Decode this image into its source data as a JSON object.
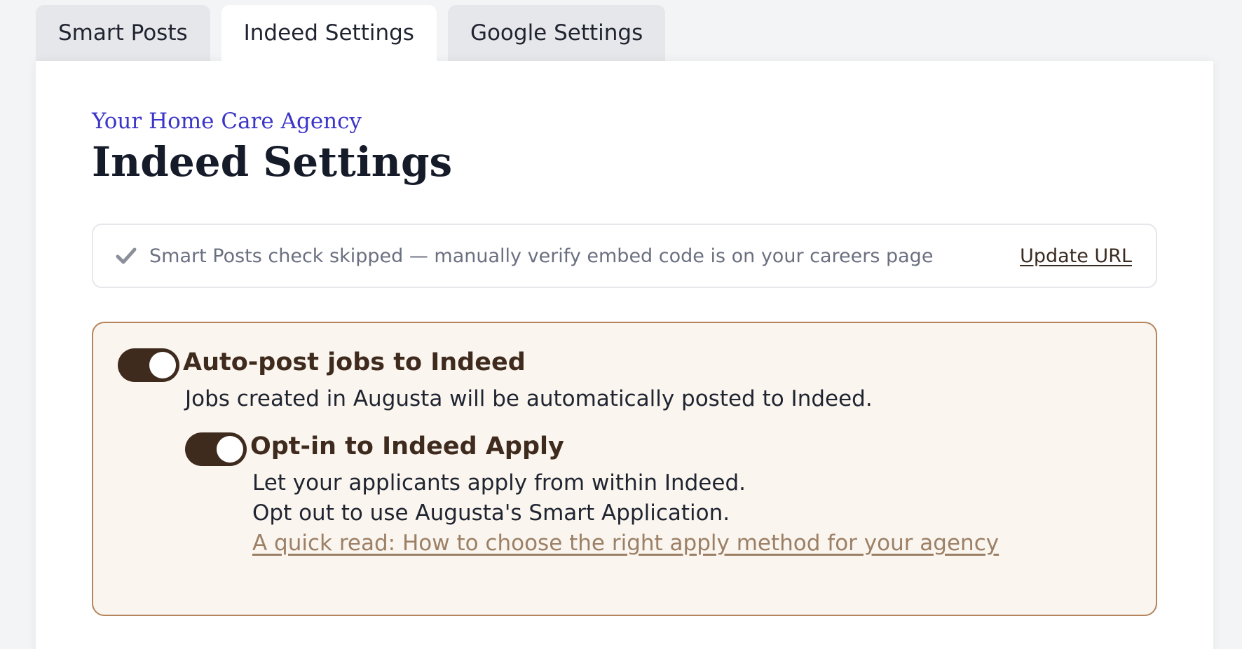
{
  "tabs": [
    {
      "label": "Smart Posts",
      "active": false
    },
    {
      "label": "Indeed Settings",
      "active": true
    },
    {
      "label": "Google Settings",
      "active": false
    }
  ],
  "header": {
    "agency": "Your Home Care Agency",
    "title": "Indeed Settings"
  },
  "notice": {
    "icon": "checkmark-icon",
    "text": "Smart Posts check skipped — manually verify embed code is on your careers page",
    "link": "Update URL"
  },
  "auto_post": {
    "enabled": true,
    "label": "Auto-post jobs to Indeed",
    "description": "Jobs created in Augusta will be automatically posted to Indeed."
  },
  "indeed_apply": {
    "enabled": true,
    "label": "Opt-in to Indeed Apply",
    "description_1": "Let your applicants apply from within Indeed.",
    "description_2": "Opt out to use Augusta's Smart Application.",
    "link": "A quick read: How to choose the right apply method for your agency"
  },
  "colors": {
    "accent_blue": "#3b35c8",
    "brown": "#3f2b1e",
    "box_border": "#b6845c",
    "box_bg": "#faf5ef",
    "link_muted": "#9c8066"
  }
}
